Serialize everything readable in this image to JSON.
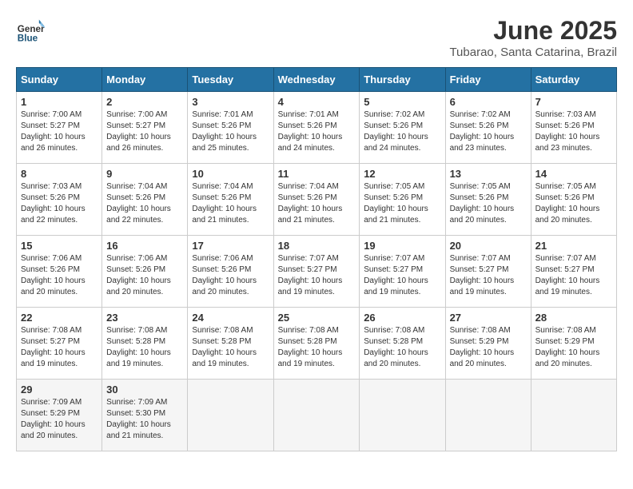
{
  "header": {
    "logo_general": "General",
    "logo_blue": "Blue",
    "month_year": "June 2025",
    "location": "Tubarao, Santa Catarina, Brazil"
  },
  "weekdays": [
    "Sunday",
    "Monday",
    "Tuesday",
    "Wednesday",
    "Thursday",
    "Friday",
    "Saturday"
  ],
  "weeks": [
    [
      {
        "day": "1",
        "sunrise": "7:00 AM",
        "sunset": "5:27 PM",
        "daylight": "10 hours and 26 minutes."
      },
      {
        "day": "2",
        "sunrise": "7:00 AM",
        "sunset": "5:27 PM",
        "daylight": "10 hours and 26 minutes."
      },
      {
        "day": "3",
        "sunrise": "7:01 AM",
        "sunset": "5:26 PM",
        "daylight": "10 hours and 25 minutes."
      },
      {
        "day": "4",
        "sunrise": "7:01 AM",
        "sunset": "5:26 PM",
        "daylight": "10 hours and 24 minutes."
      },
      {
        "day": "5",
        "sunrise": "7:02 AM",
        "sunset": "5:26 PM",
        "daylight": "10 hours and 24 minutes."
      },
      {
        "day": "6",
        "sunrise": "7:02 AM",
        "sunset": "5:26 PM",
        "daylight": "10 hours and 23 minutes."
      },
      {
        "day": "7",
        "sunrise": "7:03 AM",
        "sunset": "5:26 PM",
        "daylight": "10 hours and 23 minutes."
      }
    ],
    [
      {
        "day": "8",
        "sunrise": "7:03 AM",
        "sunset": "5:26 PM",
        "daylight": "10 hours and 22 minutes."
      },
      {
        "day": "9",
        "sunrise": "7:04 AM",
        "sunset": "5:26 PM",
        "daylight": "10 hours and 22 minutes."
      },
      {
        "day": "10",
        "sunrise": "7:04 AM",
        "sunset": "5:26 PM",
        "daylight": "10 hours and 21 minutes."
      },
      {
        "day": "11",
        "sunrise": "7:04 AM",
        "sunset": "5:26 PM",
        "daylight": "10 hours and 21 minutes."
      },
      {
        "day": "12",
        "sunrise": "7:05 AM",
        "sunset": "5:26 PM",
        "daylight": "10 hours and 21 minutes."
      },
      {
        "day": "13",
        "sunrise": "7:05 AM",
        "sunset": "5:26 PM",
        "daylight": "10 hours and 20 minutes."
      },
      {
        "day": "14",
        "sunrise": "7:05 AM",
        "sunset": "5:26 PM",
        "daylight": "10 hours and 20 minutes."
      }
    ],
    [
      {
        "day": "15",
        "sunrise": "7:06 AM",
        "sunset": "5:26 PM",
        "daylight": "10 hours and 20 minutes."
      },
      {
        "day": "16",
        "sunrise": "7:06 AM",
        "sunset": "5:26 PM",
        "daylight": "10 hours and 20 minutes."
      },
      {
        "day": "17",
        "sunrise": "7:06 AM",
        "sunset": "5:26 PM",
        "daylight": "10 hours and 20 minutes."
      },
      {
        "day": "18",
        "sunrise": "7:07 AM",
        "sunset": "5:27 PM",
        "daylight": "10 hours and 19 minutes."
      },
      {
        "day": "19",
        "sunrise": "7:07 AM",
        "sunset": "5:27 PM",
        "daylight": "10 hours and 19 minutes."
      },
      {
        "day": "20",
        "sunrise": "7:07 AM",
        "sunset": "5:27 PM",
        "daylight": "10 hours and 19 minutes."
      },
      {
        "day": "21",
        "sunrise": "7:07 AM",
        "sunset": "5:27 PM",
        "daylight": "10 hours and 19 minutes."
      }
    ],
    [
      {
        "day": "22",
        "sunrise": "7:08 AM",
        "sunset": "5:27 PM",
        "daylight": "10 hours and 19 minutes."
      },
      {
        "day": "23",
        "sunrise": "7:08 AM",
        "sunset": "5:28 PM",
        "daylight": "10 hours and 19 minutes."
      },
      {
        "day": "24",
        "sunrise": "7:08 AM",
        "sunset": "5:28 PM",
        "daylight": "10 hours and 19 minutes."
      },
      {
        "day": "25",
        "sunrise": "7:08 AM",
        "sunset": "5:28 PM",
        "daylight": "10 hours and 19 minutes."
      },
      {
        "day": "26",
        "sunrise": "7:08 AM",
        "sunset": "5:28 PM",
        "daylight": "10 hours and 20 minutes."
      },
      {
        "day": "27",
        "sunrise": "7:08 AM",
        "sunset": "5:29 PM",
        "daylight": "10 hours and 20 minutes."
      },
      {
        "day": "28",
        "sunrise": "7:08 AM",
        "sunset": "5:29 PM",
        "daylight": "10 hours and 20 minutes."
      }
    ],
    [
      {
        "day": "29",
        "sunrise": "7:09 AM",
        "sunset": "5:29 PM",
        "daylight": "10 hours and 20 minutes."
      },
      {
        "day": "30",
        "sunrise": "7:09 AM",
        "sunset": "5:30 PM",
        "daylight": "10 hours and 21 minutes."
      },
      null,
      null,
      null,
      null,
      null
    ]
  ]
}
